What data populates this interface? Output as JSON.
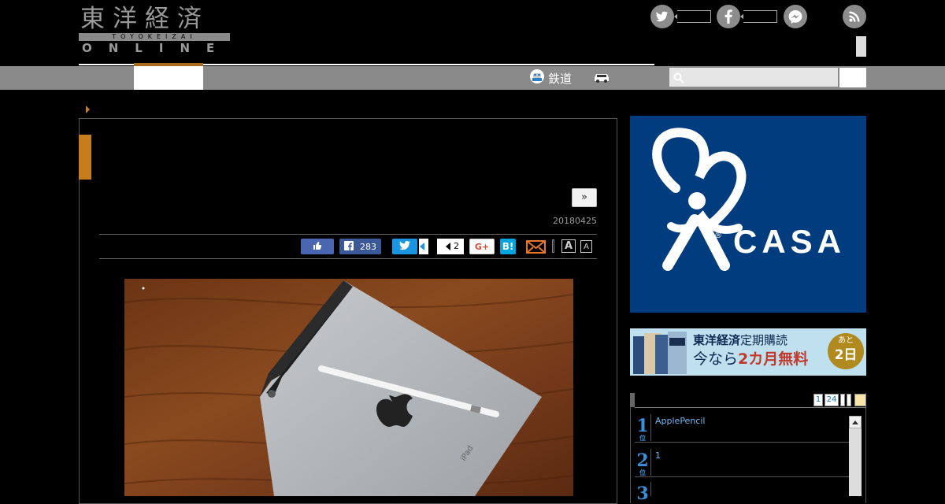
{
  "header": {
    "logo": {
      "kanji": "東洋経済",
      "romaji": "TOYOKEIZAI",
      "online": "ONLINE"
    },
    "social": [
      {
        "name": "twitter",
        "icon": "twitter-icon"
      },
      {
        "name": "facebook",
        "icon": "facebook-icon"
      },
      {
        "name": "messenger",
        "icon": "messenger-icon"
      },
      {
        "name": "rss",
        "icon": "rss-icon"
      }
    ]
  },
  "nav": {
    "rail_label": "鉄道",
    "search_placeholder": ""
  },
  "article": {
    "next_label": "»",
    "date": "20180425",
    "share": {
      "facebook_count": "283",
      "pocket_count": "2",
      "gplus_label": "G+",
      "hatena_label": "B!",
      "font_large": "A",
      "font_small": "A"
    }
  },
  "sidebar": {
    "ad_casa_text": "CASA",
    "ad_sub": {
      "brand": "東洋経済",
      "line1": "定期購読",
      "line2_pre": "今なら",
      "line2_em": "2カ月無料",
      "badge_top": "あと",
      "badge_bottom": "2日"
    },
    "ranking": {
      "tabs": [
        "1",
        "24"
      ],
      "items": [
        {
          "rank": "1",
          "suffix": "位",
          "title": "ApplePencil"
        },
        {
          "rank": "2",
          "suffix": "位",
          "title": "1"
        },
        {
          "rank": "3",
          "suffix": "位",
          "title": ""
        }
      ]
    }
  },
  "colors": {
    "accent_orange": "#c57d1e",
    "nav_gray": "#8a8a8a",
    "casa_blue": "#003c7e"
  }
}
